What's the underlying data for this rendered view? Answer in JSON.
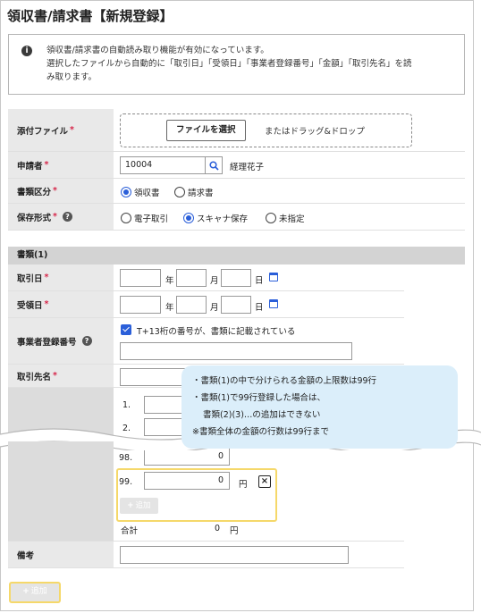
{
  "page": {
    "title": "領収書/請求書【新規登録】"
  },
  "info": {
    "line1": "領収書/請求書の自動読み取り機能が有効になっています。",
    "line2": "選択したファイルから自動的に「取引日」「受領日」「事業者登録番号」「金額」「取引先名」を読",
    "line3": "み取ります。"
  },
  "form": {
    "attachment": {
      "label": "添付ファイル",
      "required_mark": "*",
      "button_label": "ファイルを選択",
      "drop_text": "またはドラッグ&ドロップ"
    },
    "applicant": {
      "label": "申請者",
      "required_mark": "*",
      "code_value": "10004",
      "name": "経理花子"
    },
    "doc_type": {
      "label": "書類区分",
      "required_mark": "*",
      "options": [
        "領収書",
        "請求書"
      ],
      "selected": "領収書"
    },
    "storage": {
      "label": "保存形式",
      "required_mark": "*",
      "options": [
        "電子取引",
        "スキャナ保存",
        "未指定"
      ],
      "selected": "スキャナ保存"
    }
  },
  "document": {
    "section_title": "書類(1)",
    "trade_date": {
      "label": "取引日",
      "required_mark": "*",
      "units": [
        "年",
        "月",
        "日"
      ]
    },
    "received_date": {
      "label": "受領日",
      "required_mark": "*",
      "units": [
        "年",
        "月",
        "日"
      ]
    },
    "registration": {
      "label": "事業者登録番号",
      "checkbox_label": "T+13桁の番号が、書類に記載されている",
      "checked": true
    },
    "vendor": {
      "label": "取引先名",
      "required_mark": "*"
    },
    "amounts": {
      "rows": [
        {
          "no": "1.",
          "value": ""
        },
        {
          "no": "2.",
          "value": ""
        },
        {
          "no": "98.",
          "value": "0"
        },
        {
          "no": "99.",
          "value": "0",
          "unit": "円"
        }
      ],
      "remove_symbol": "×",
      "add_label": "追加",
      "total_label": "合計",
      "total_value": "0",
      "total_unit": "円"
    },
    "remarks": {
      "label": "備考"
    }
  },
  "tooltip": {
    "line1": "・書類(1)の中で分けられる金額の上限数は99行",
    "line2": "・書類(1)で99行登録した場合は、",
    "line3": "書類(2)(3)…の追加はできない",
    "line4": "※書類全体の金額の行数は99行まで"
  },
  "bottom": {
    "add_label": "追加"
  },
  "colors": {
    "accent": "#2b5fd9",
    "required": "#d6264a",
    "highlight": "#f5d86a",
    "tooltip_bg": "#dbeefa"
  }
}
